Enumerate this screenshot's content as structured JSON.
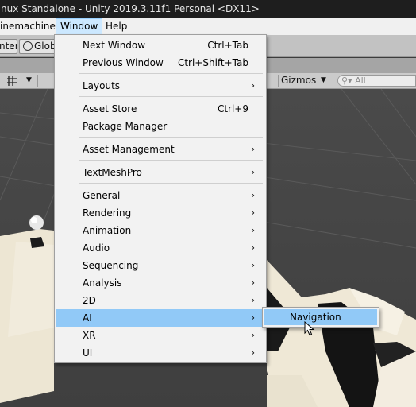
{
  "title": "nux Standalone - Unity 2019.3.11f1 Personal <DX11>",
  "menubar": {
    "items": [
      {
        "label": "inemachine",
        "active": false
      },
      {
        "label": "Window",
        "active": true
      },
      {
        "label": "Help",
        "active": false
      }
    ]
  },
  "toolbar": {
    "pivot_label": "nter",
    "global_label": "Glob"
  },
  "scene_toolbar": {
    "gizmos_label": "Gizmos",
    "search_placeholder": "All"
  },
  "window_menu": {
    "items": [
      {
        "label": "Next Window",
        "shortcut": "Ctrl+Tab",
        "submenu": false
      },
      {
        "label": "Previous Window",
        "shortcut": "Ctrl+Shift+Tab",
        "submenu": false
      },
      {
        "label": "Layouts",
        "shortcut": "",
        "submenu": true
      },
      {
        "label": "Asset Store",
        "shortcut": "Ctrl+9",
        "submenu": false
      },
      {
        "label": "Package Manager",
        "shortcut": "",
        "submenu": false
      },
      {
        "label": "Asset Management",
        "shortcut": "",
        "submenu": true
      },
      {
        "label": "TextMeshPro",
        "shortcut": "",
        "submenu": true
      },
      {
        "label": "General",
        "shortcut": "",
        "submenu": true
      },
      {
        "label": "Rendering",
        "shortcut": "",
        "submenu": true
      },
      {
        "label": "Animation",
        "shortcut": "",
        "submenu": true
      },
      {
        "label": "Audio",
        "shortcut": "",
        "submenu": true
      },
      {
        "label": "Sequencing",
        "shortcut": "",
        "submenu": true
      },
      {
        "label": "Analysis",
        "shortcut": "",
        "submenu": true
      },
      {
        "label": "2D",
        "shortcut": "",
        "submenu": true
      },
      {
        "label": "AI",
        "shortcut": "",
        "submenu": true,
        "highlighted": true
      },
      {
        "label": "XR",
        "shortcut": "",
        "submenu": true
      },
      {
        "label": "UI",
        "shortcut": "",
        "submenu": true
      }
    ],
    "submenu_arrow": "›"
  },
  "ai_submenu": {
    "items": [
      {
        "label": "Navigation",
        "highlighted": true
      }
    ]
  },
  "colors": {
    "highlight": "#91c9f7",
    "menubar_active": "#cce8ff",
    "menu_bg": "#f2f2f2",
    "titlebar_bg": "#1e1e1e"
  }
}
